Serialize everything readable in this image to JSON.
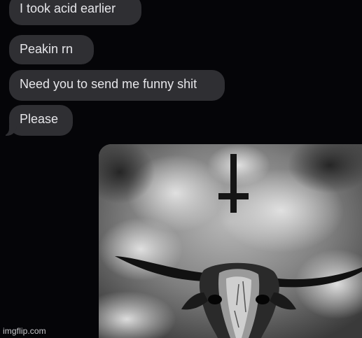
{
  "messages": [
    {
      "text": "I took acid earlier"
    },
    {
      "text": "Peakin rn"
    },
    {
      "text": "Need you to send me funny shit"
    },
    {
      "text": "Please"
    }
  ],
  "attachment": {
    "icon": "image-attachment"
  },
  "watermark": "imgflip.com",
  "colors": {
    "background": "#050508",
    "bubble": "#2f2f33",
    "bubble_text": "#e6e6ea"
  }
}
